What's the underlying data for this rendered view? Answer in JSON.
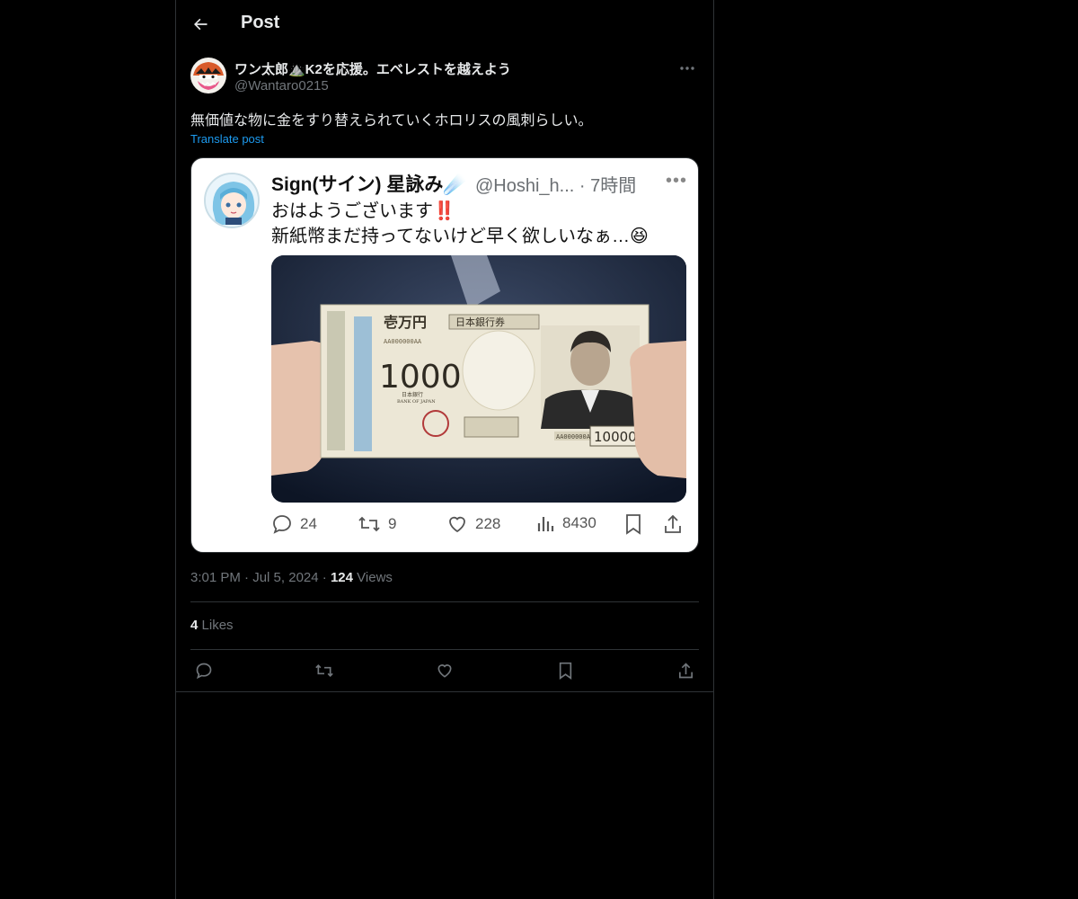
{
  "header": {
    "title": "Post",
    "back_icon": "arrow-left-icon"
  },
  "post": {
    "author": {
      "display_name": "ワン太郎⛰️K2を応援。エベレストを越えよう",
      "handle": "@Wantaro0215"
    },
    "text": "無価値な物に金をすり替えられていくホロリスの風刺らしい。",
    "translate_label": "Translate post",
    "timestamp": "3:01 PM",
    "date": "Jul 5, 2024",
    "views_count": "124",
    "views_label": "Views",
    "likes_count": "4",
    "likes_label": "Likes"
  },
  "embedded": {
    "name": "Sign(サイン) 星詠み☄️",
    "handle_time": "@Hoshi_h... · 7時間",
    "line1": "おはようございます‼️",
    "line2": "新紙幣まだ持ってないけど早く欲しいなぁ…😆",
    "banknote": {
      "top_label": "壱万円",
      "bank_label": "日本銀行券",
      "serial": "AA000000AA",
      "amount": "10000",
      "sub_label": "日本銀行",
      "sub_label_en": "BANK OF JAPAN"
    },
    "stats": {
      "replies": "24",
      "reposts": "9",
      "likes": "228",
      "views": "8430"
    }
  },
  "colors": {
    "background": "#000000",
    "border": "#2f3336",
    "text_primary": "#e7e9ea",
    "text_secondary": "#71767b",
    "accent": "#1d9bf0"
  }
}
